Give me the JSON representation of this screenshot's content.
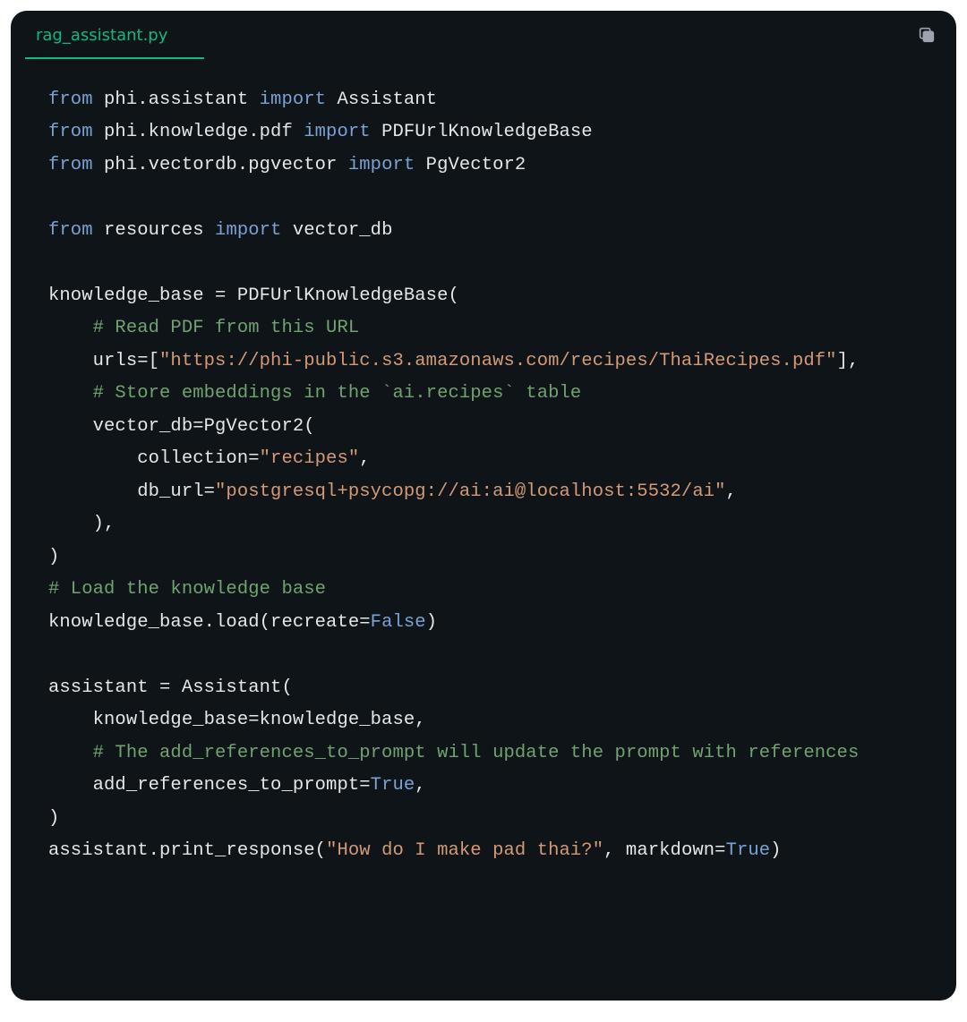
{
  "tab": {
    "filename": "rag_assistant.py"
  },
  "icons": {
    "copy": "copy-icon"
  },
  "code": {
    "lines": [
      {
        "segments": [
          {
            "t": "from",
            "cls": "k"
          },
          {
            "t": " phi.assistant ",
            "cls": "n"
          },
          {
            "t": "import",
            "cls": "k"
          },
          {
            "t": " Assistant",
            "cls": "n"
          }
        ]
      },
      {
        "segments": [
          {
            "t": "from",
            "cls": "k"
          },
          {
            "t": " phi.knowledge.pdf ",
            "cls": "n"
          },
          {
            "t": "import",
            "cls": "k"
          },
          {
            "t": " PDFUrlKnowledgeBase",
            "cls": "n"
          }
        ]
      },
      {
        "segments": [
          {
            "t": "from",
            "cls": "k"
          },
          {
            "t": " phi.vectordb.pgvector ",
            "cls": "n"
          },
          {
            "t": "import",
            "cls": "k"
          },
          {
            "t": " PgVector2",
            "cls": "n"
          }
        ]
      },
      {
        "segments": []
      },
      {
        "segments": [
          {
            "t": "from",
            "cls": "k"
          },
          {
            "t": " resources ",
            "cls": "n"
          },
          {
            "t": "import",
            "cls": "k"
          },
          {
            "t": " vector_db",
            "cls": "n"
          }
        ]
      },
      {
        "segments": []
      },
      {
        "segments": [
          {
            "t": "knowledge_base = PDFUrlKnowledgeBase(",
            "cls": "p"
          }
        ]
      },
      {
        "segments": [
          {
            "t": "    ",
            "cls": "p"
          },
          {
            "t": "# Read PDF from this URL",
            "cls": "c"
          }
        ]
      },
      {
        "segments": [
          {
            "t": "    urls=[",
            "cls": "p"
          },
          {
            "t": "\"https://phi-public.s3.amazonaws.com/recipes/ThaiRecipes.pdf\"",
            "cls": "s"
          },
          {
            "t": "],",
            "cls": "p"
          }
        ]
      },
      {
        "segments": [
          {
            "t": "    ",
            "cls": "p"
          },
          {
            "t": "# Store embeddings in the `ai.recipes` table",
            "cls": "c"
          }
        ]
      },
      {
        "segments": [
          {
            "t": "    vector_db=PgVector2(",
            "cls": "p"
          }
        ]
      },
      {
        "segments": [
          {
            "t": "        collection=",
            "cls": "p"
          },
          {
            "t": "\"recipes\"",
            "cls": "s"
          },
          {
            "t": ",",
            "cls": "p"
          }
        ]
      },
      {
        "segments": [
          {
            "t": "        db_url=",
            "cls": "p"
          },
          {
            "t": "\"postgresql+psycopg://ai:ai@localhost:5532/ai\"",
            "cls": "s"
          },
          {
            "t": ",",
            "cls": "p"
          }
        ]
      },
      {
        "segments": [
          {
            "t": "    ),",
            "cls": "p"
          }
        ]
      },
      {
        "segments": [
          {
            "t": ")",
            "cls": "p"
          }
        ]
      },
      {
        "segments": [
          {
            "t": "# Load the knowledge base",
            "cls": "c"
          }
        ]
      },
      {
        "segments": [
          {
            "t": "knowledge_base.load(recreate=",
            "cls": "p"
          },
          {
            "t": "False",
            "cls": "b"
          },
          {
            "t": ")",
            "cls": "p"
          }
        ]
      },
      {
        "segments": []
      },
      {
        "segments": [
          {
            "t": "assistant = Assistant(",
            "cls": "p"
          }
        ]
      },
      {
        "segments": [
          {
            "t": "    knowledge_base=knowledge_base,",
            "cls": "p"
          }
        ]
      },
      {
        "segments": [
          {
            "t": "    ",
            "cls": "p"
          },
          {
            "t": "# The add_references_to_prompt will update the prompt with references",
            "cls": "c"
          }
        ]
      },
      {
        "segments": [
          {
            "t": "    add_references_to_prompt=",
            "cls": "p"
          },
          {
            "t": "True",
            "cls": "b"
          },
          {
            "t": ",",
            "cls": "p"
          }
        ]
      },
      {
        "segments": [
          {
            "t": ")",
            "cls": "p"
          }
        ]
      },
      {
        "segments": [
          {
            "t": "assistant.print_response(",
            "cls": "p"
          },
          {
            "t": "\"How do I make pad thai?\"",
            "cls": "s"
          },
          {
            "t": ", markdown=",
            "cls": "p"
          },
          {
            "t": "True",
            "cls": "b"
          },
          {
            "t": ")",
            "cls": "p"
          }
        ]
      }
    ]
  }
}
